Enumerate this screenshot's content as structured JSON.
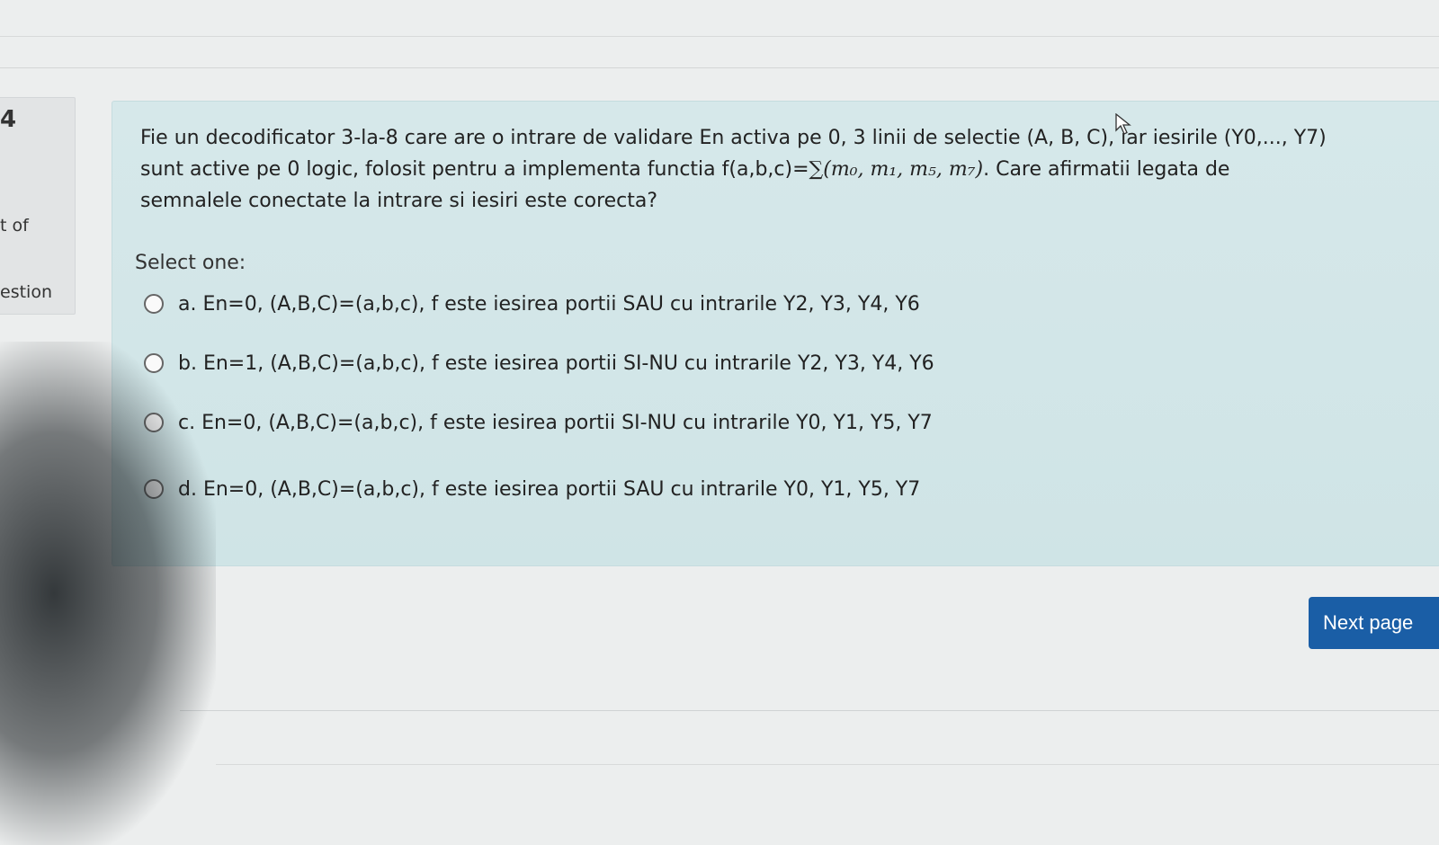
{
  "sidebar": {
    "number": "4",
    "out_of": "t of",
    "flag": "estion"
  },
  "question": {
    "text_prefix": "Fie un decodificator 3-la-8 care are o intrare de validare En activa pe 0,  3 linii de selectie (A, B, C), iar iesirile (Y0,..., Y7) sunt active pe 0 logic, folosit pentru a implementa functia f(a,b,c)=",
    "formula": "∑(m₀, m₁, m₅, m₇)",
    "text_suffix": ". Care afirmatii legata de semnalele conectate la intrare si iesiri este corecta?",
    "select_one": "Select one:",
    "options": [
      {
        "label": "a. En=0, (A,B,C)=(a,b,c), f este iesirea portii SAU cu intrarile Y2, Y3, Y4, Y6"
      },
      {
        "label": "b. En=1, (A,B,C)=(a,b,c), f este iesirea portii SI-NU cu intrarile Y2, Y3, Y4, Y6"
      },
      {
        "label": "c. En=0, (A,B,C)=(a,b,c), f este iesirea portii SI-NU cu intrarile Y0, Y1, Y5, Y7"
      },
      {
        "label": "d. En=0, (A,B,C)=(a,b,c), f este iesirea portii SAU cu intrarile Y0, Y1, Y5, Y7"
      }
    ]
  },
  "navigation": {
    "next_label": "Next page"
  },
  "colors": {
    "card_bg": "#d3e6e8",
    "next_button": "#1a5ea6"
  }
}
